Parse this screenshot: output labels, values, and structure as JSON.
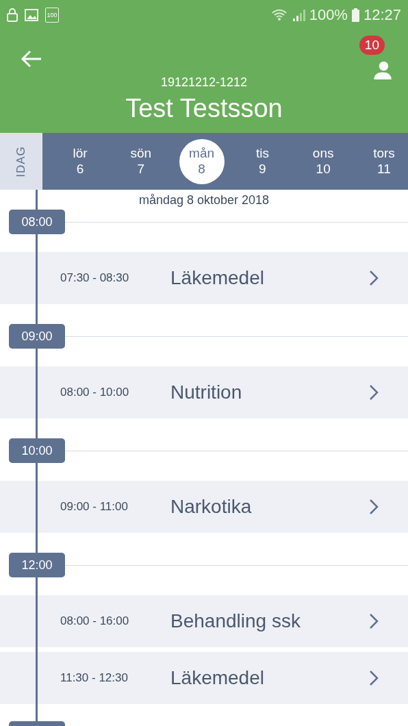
{
  "status_bar": {
    "battery_label": "100",
    "battery_percent": "100%",
    "time": "12:27"
  },
  "header": {
    "notification_count": "10",
    "patient_id": "19121212-1212",
    "patient_name": "Test Testsson"
  },
  "week": {
    "today_label": "IDAG",
    "days": [
      {
        "weekday": "lör",
        "date": "6",
        "selected": false
      },
      {
        "weekday": "sön",
        "date": "7",
        "selected": false
      },
      {
        "weekday": "mån",
        "date": "8",
        "selected": true
      },
      {
        "weekday": "tis",
        "date": "9",
        "selected": false
      },
      {
        "weekday": "ons",
        "date": "10",
        "selected": false
      },
      {
        "weekday": "tors",
        "date": "11",
        "selected": false
      }
    ]
  },
  "schedule": {
    "date_label": "måndag 8 oktober 2018",
    "hours": [
      {
        "hour": "08:00",
        "events": [
          {
            "time": "07:30 - 08:30",
            "title": "Läkemedel"
          }
        ]
      },
      {
        "hour": "09:00",
        "events": [
          {
            "time": "08:00 - 10:00",
            "title": "Nutrition"
          }
        ]
      },
      {
        "hour": "10:00",
        "events": [
          {
            "time": "09:00 - 11:00",
            "title": "Narkotika"
          }
        ]
      },
      {
        "hour": "12:00",
        "events": [
          {
            "time": "08:00 - 16:00",
            "title": "Behandling ssk"
          },
          {
            "time": "11:30 - 12:30",
            "title": "Läkemedel"
          }
        ]
      }
    ]
  }
}
